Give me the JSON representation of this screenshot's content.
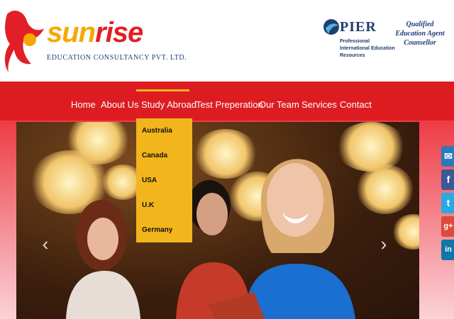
{
  "brand": {
    "name_prefix": "sun",
    "name_rest": "rise",
    "subtitle": "EDUCATION CONSULTANCY PVT. LTD."
  },
  "partner": {
    "name": "PIER",
    "description": "Professional International Education Resources",
    "tagline": "Qualified Education Agent Counsellor"
  },
  "nav": {
    "items": [
      "Home",
      "About Us",
      "Study Abroad",
      "Test Preperation",
      "Our Team",
      "Services",
      "Contact"
    ],
    "active": "Study Abroad"
  },
  "dropdown": {
    "items": [
      "Australia",
      "Canada",
      "USA",
      "U.K",
      "Germany"
    ]
  },
  "slider": {
    "prev_glyph": "‹",
    "next_glyph": "›"
  },
  "social": [
    {
      "icon": "email-icon",
      "glyph": "✉",
      "color": "#2b7bb9"
    },
    {
      "icon": "facebook-icon",
      "glyph": "f",
      "color": "#3b5998"
    },
    {
      "icon": "twitter-icon",
      "glyph": "t",
      "color": "#29a9e1"
    },
    {
      "icon": "google-plus-icon",
      "glyph": "g+",
      "color": "#dd4b39"
    },
    {
      "icon": "linkedin-icon",
      "glyph": "in",
      "color": "#0e76a8"
    }
  ],
  "colors": {
    "nav_red": "#dd1c22",
    "dropdown_gold": "#f2b51c",
    "brand_orange": "#f6a800",
    "brand_red": "#e21f26"
  }
}
